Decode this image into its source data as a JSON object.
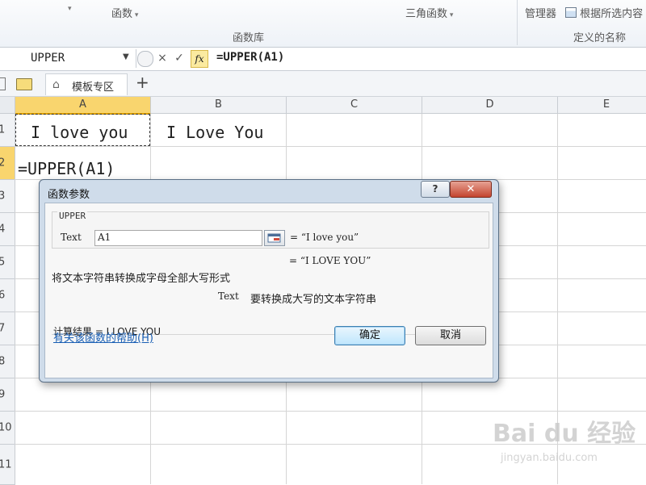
{
  "ribbon": {
    "function_dropdown": "函数",
    "trig_dropdown": "三角函数",
    "name_manager": "管理器",
    "create_from_selection": "根据所选内容",
    "group_function_library": "函数库",
    "group_defined_names": "定义的名称"
  },
  "formula_bar": {
    "name_box": "UPPER",
    "formula": "=UPPER(A1)",
    "cancel_icon": "×",
    "enter_icon": "✓",
    "fx_label": "fx"
  },
  "tabs": {
    "template_tab": "模板专区",
    "add": "+"
  },
  "sheet": {
    "columns": [
      "A",
      "B",
      "C",
      "D",
      "E"
    ],
    "rows": [
      "1",
      "2",
      "3",
      "4",
      "5",
      "6",
      "7",
      "8",
      "9",
      "10",
      "11"
    ],
    "cells": {
      "A1": "I love you",
      "B1": "I Love You",
      "A2": "=UPPER(A1)"
    }
  },
  "dialog": {
    "title": "函数参数",
    "help_icon": "?",
    "close_icon": "✕",
    "function_name": "UPPER",
    "arg_label": "Text",
    "arg_value": "A1",
    "arg_eval": "= “I love you”",
    "result_preview": "= “I LOVE YOU”",
    "description": "将文本字符串转换成字母全部大写形式",
    "arg_help_label": "Text",
    "arg_help_text": "要转换成大写的文本字符串",
    "calc_result": "计算结果 = I LOVE YOU",
    "help_link": "有关该函数的帮助(H)",
    "ok": "确定",
    "cancel": "取消"
  },
  "watermark": {
    "logo": "Bai du 经验",
    "url": "jingyan.baidu.com"
  }
}
